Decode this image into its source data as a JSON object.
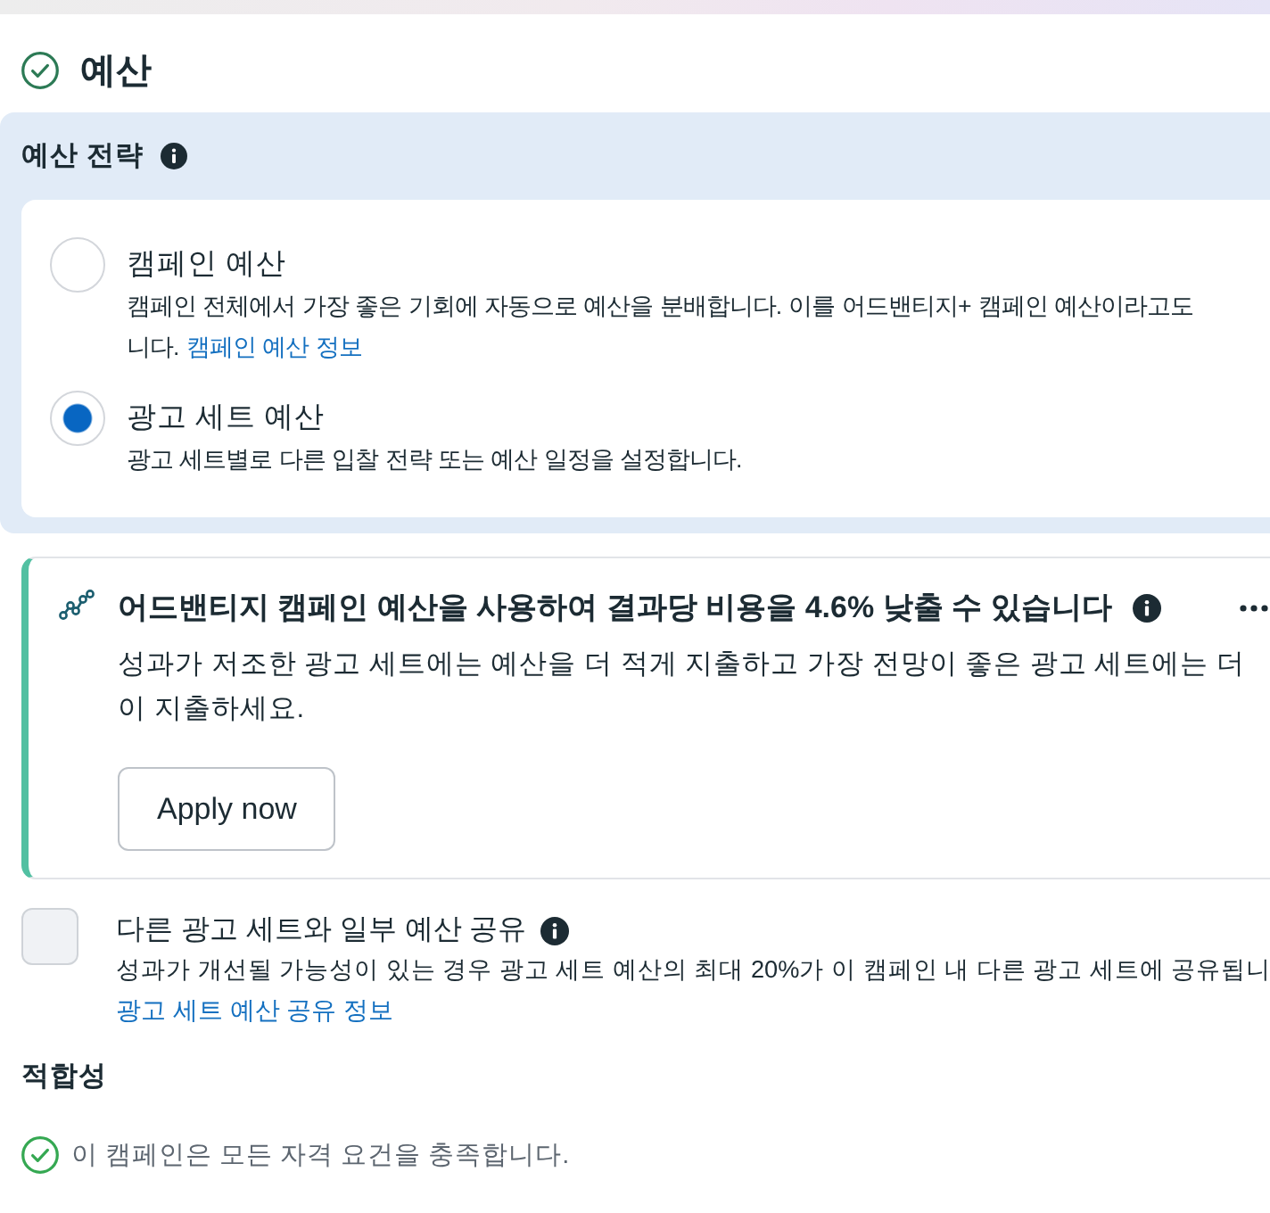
{
  "section": {
    "title": "예산"
  },
  "budget_strategy": {
    "title": "예산 전략",
    "options": [
      {
        "title": "캠페인 예산",
        "description_lines": [
          "캠페인 전체에서 가장 좋은 기회에 자동으로 예산을 분배합니다. 이를 어드밴티지+ 캠페인 예산이라고도",
          "니다."
        ],
        "link": "캠페인 예산 정보",
        "selected": false
      },
      {
        "title": "광고 세트 예산",
        "description_lines": [
          "광고 세트별로 다른 입찰 전략 또는 예산 일정을 설정합니다."
        ],
        "selected": true
      }
    ]
  },
  "recommendation": {
    "title": "어드밴티지 캠페인 예산을 사용하여 결과당 비용을 4.6% 낮출 수 있습니다",
    "body_lines": [
      "성과가 저조한 광고 세트에는 예산을 더 적게 지출하고 가장 전망이 좋은 광고 세트에는 더",
      "이 지출하세요."
    ],
    "button": "Apply now"
  },
  "budget_sharing": {
    "label": "다른 광고 세트와 일부 예산 공유",
    "checked": false,
    "description": "성과가 개선될 가능성이 있는 경우 광고 세트 예산의 최대 20%가 이 캠페인 내 다른 광고 세트에 공유됩니",
    "link": "광고 세트 예산 공유 정보"
  },
  "eligibility": {
    "title": "적합성",
    "message": "이 캠페인은 모든 자격 요건을 충족합니다."
  }
}
